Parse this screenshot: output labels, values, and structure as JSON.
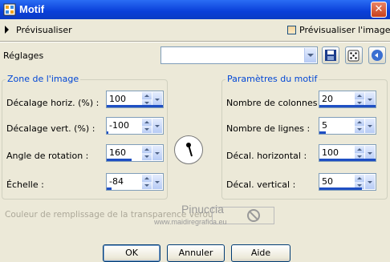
{
  "window": {
    "title": "Motif"
  },
  "preview": {
    "label": "Prévisualiser",
    "image_label": "Prévisualiser l'image"
  },
  "presets": {
    "label": "Réglages",
    "value": ""
  },
  "zone": {
    "legend": "Zone de l'image",
    "fields": [
      {
        "label": "Décalage horiz. (%) :",
        "value": "100",
        "level": 1.0
      },
      {
        "label": "Décalage vert. (%) :",
        "value": "-100",
        "level": 0.0
      },
      {
        "label": "Angle de rotation :",
        "value": "160",
        "level": 0.44
      },
      {
        "label": "Échelle :",
        "value": "-84",
        "level": 0.08
      }
    ]
  },
  "params": {
    "legend": "Paramètres du motif",
    "fields": [
      {
        "label": "Nombre de colonnes :",
        "value": "20",
        "level": 1.0
      },
      {
        "label": "Nombre de lignes :",
        "value": "5",
        "level": 0.12
      },
      {
        "label": "Décal. horizontal :",
        "value": "100",
        "level": 1.0
      },
      {
        "label": "Décal. vertical :",
        "value": "50",
        "level": 0.75
      }
    ]
  },
  "fill": {
    "label": "Couleur de remplissage de la transparence verouillée"
  },
  "watermark": {
    "line1": "Pinuccia",
    "line2": "www.maidiregrafica.eu"
  },
  "buttons": {
    "ok": "OK",
    "cancel": "Annuler",
    "help": "Aide"
  },
  "icons": [
    "app-icon",
    "close-icon",
    "expand-triangle-icon",
    "checkbox-icon",
    "dropdown-arrow-icon",
    "save-icon",
    "dice-icon",
    "reset-icon",
    "rotation-dial-icon",
    "no-symbol-icon"
  ],
  "colors": {
    "titlebar": "#0a3fd8",
    "legend": "#0046d5",
    "spin_bar": "#1f4fc3"
  }
}
